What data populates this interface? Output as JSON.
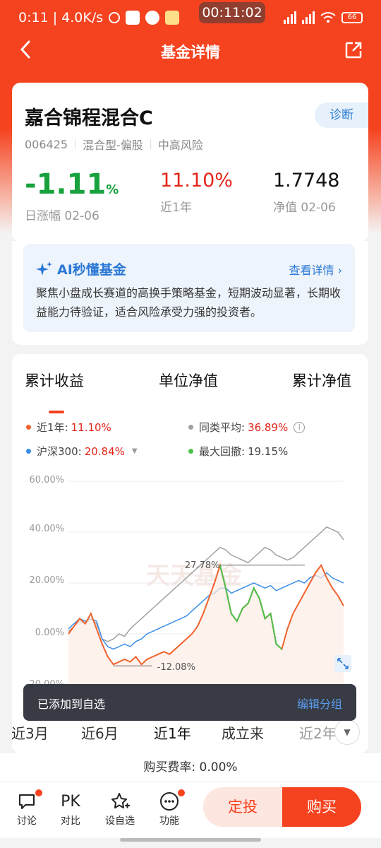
{
  "status_bar": {
    "left_text": "0:11 | 4.0K/s",
    "clock": "00:11:02",
    "battery": "66"
  },
  "nav": {
    "title": "基金详情"
  },
  "fund": {
    "name": "嘉合锦程混合C",
    "diagnose": "诊断",
    "code": "006425",
    "type": "混合型-偏股",
    "risk": "中高风险",
    "daily_change": "-1.11",
    "daily_change_unit": "%",
    "daily_change_label": "日涨幅 02-06",
    "one_year": "11.10%",
    "one_year_label": "近1年",
    "nav_value": "1.7748",
    "nav_label": "净值 02-06"
  },
  "ai": {
    "title": "AI秒懂基金",
    "link": "查看详情",
    "summary": "聚焦小盘成长赛道的高换手策略基金，短期波动显著，长期收益能力待验证，适合风险承受力强的投资者。"
  },
  "chart_tabs": [
    "累计收益",
    "单位净值",
    "累计净值"
  ],
  "legend": {
    "fund_label": "近1年:",
    "fund_value": "11.10%",
    "peer_label": "同类平均:",
    "peer_value": "36.89%",
    "index_label": "沪深300:",
    "index_value": "20.84%",
    "drawdown_label": "最大回撤:",
    "drawdown_value": "19.15%"
  },
  "colors": {
    "fund": "#f0622d",
    "peer": "#a0a0a0",
    "index": "#3a8ee6",
    "drawdown": "#4cc04a"
  },
  "chart_data": {
    "type": "line",
    "ylim": [
      -20,
      60
    ],
    "yticks": [
      "60.00%",
      "40.00%",
      "20.00%",
      "0.00%",
      "-20.00%"
    ],
    "annotations": [
      "27.78%",
      "-12.08%"
    ],
    "watermark": "天天基金",
    "series": [
      {
        "name": "近1年",
        "values": [
          0,
          3,
          6,
          4,
          8,
          2,
          -4,
          -9,
          -12,
          -11,
          -10,
          -11,
          -9,
          -12,
          -10,
          -9,
          -8,
          -7,
          -8,
          -6,
          -4,
          -2,
          0,
          3,
          8,
          14,
          20,
          27,
          18,
          8,
          5,
          10,
          12,
          18,
          14,
          6,
          8,
          -4,
          -6,
          2,
          8,
          12,
          16,
          20,
          24,
          27,
          22,
          18,
          15,
          11
        ]
      },
      {
        "name": "同类平均",
        "values": [
          1,
          3,
          5,
          4,
          6,
          4,
          -2,
          -3,
          -2,
          0,
          -1,
          2,
          4,
          6,
          8,
          10,
          12,
          14,
          16,
          18,
          20,
          22,
          24,
          26,
          28,
          30,
          32,
          34,
          33,
          31,
          30,
          29,
          28,
          30,
          32,
          34,
          33,
          31,
          30,
          29,
          30,
          32,
          34,
          36,
          38,
          40,
          42,
          41,
          40,
          37
        ]
      },
      {
        "name": "沪深300",
        "values": [
          2,
          4,
          6,
          5,
          6,
          5,
          -2,
          -5,
          -6,
          -5,
          -4,
          -5,
          -3,
          -2,
          0,
          1,
          2,
          3,
          4,
          5,
          6,
          7,
          9,
          11,
          13,
          15,
          16,
          18,
          18,
          16,
          17,
          18,
          19,
          20,
          19,
          18,
          19,
          17,
          18,
          19,
          20,
          21,
          20,
          22,
          23,
          22,
          24,
          22,
          21,
          20
        ]
      }
    ]
  },
  "periods": [
    "近3月",
    "近6月",
    "近1年",
    "成立来",
    "近2年"
  ],
  "toast": {
    "message": "已添加到自选",
    "action": "编辑分组"
  },
  "fee": "购买费率: 0.00%",
  "bottom": {
    "discuss": "讨论",
    "pk_icon": "PK",
    "compare": "对比",
    "watch": "设自选",
    "functions": "功能",
    "auto_invest": "定投",
    "buy": "购买"
  }
}
